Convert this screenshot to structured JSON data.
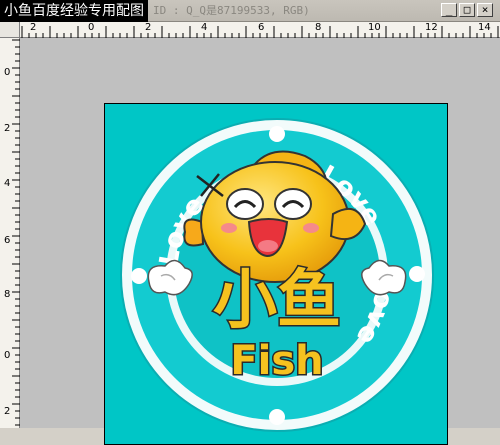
{
  "window": {
    "title": "小鱼百度经验专用配图",
    "title_faded": "ID : Q_Q是87199533, RGB)",
    "buttons": {
      "minimize": "_",
      "maximize": "□",
      "close": "×"
    }
  },
  "rulers": {
    "horizontal": [
      "2",
      "0",
      "2",
      "4",
      "6",
      "8",
      "10",
      "12",
      "14"
    ],
    "vertical": [
      "0",
      "2",
      "4",
      "6",
      "8",
      "0",
      "2"
    ]
  },
  "artwork": {
    "top_text": "Love",
    "right_text": "Love",
    "bottom_text": "Love",
    "title": "小鱼",
    "subtitle": "Fish",
    "colors": {
      "background": "#00c6c6",
      "ring_outer": "#f2fbfb",
      "ring_mid": "#13cbd0",
      "ring_inner": "#eaf9f9",
      "fish_body": "#f7c21a",
      "title_fill": "#f6c21f",
      "title_outline": "#2a2a2a"
    }
  }
}
